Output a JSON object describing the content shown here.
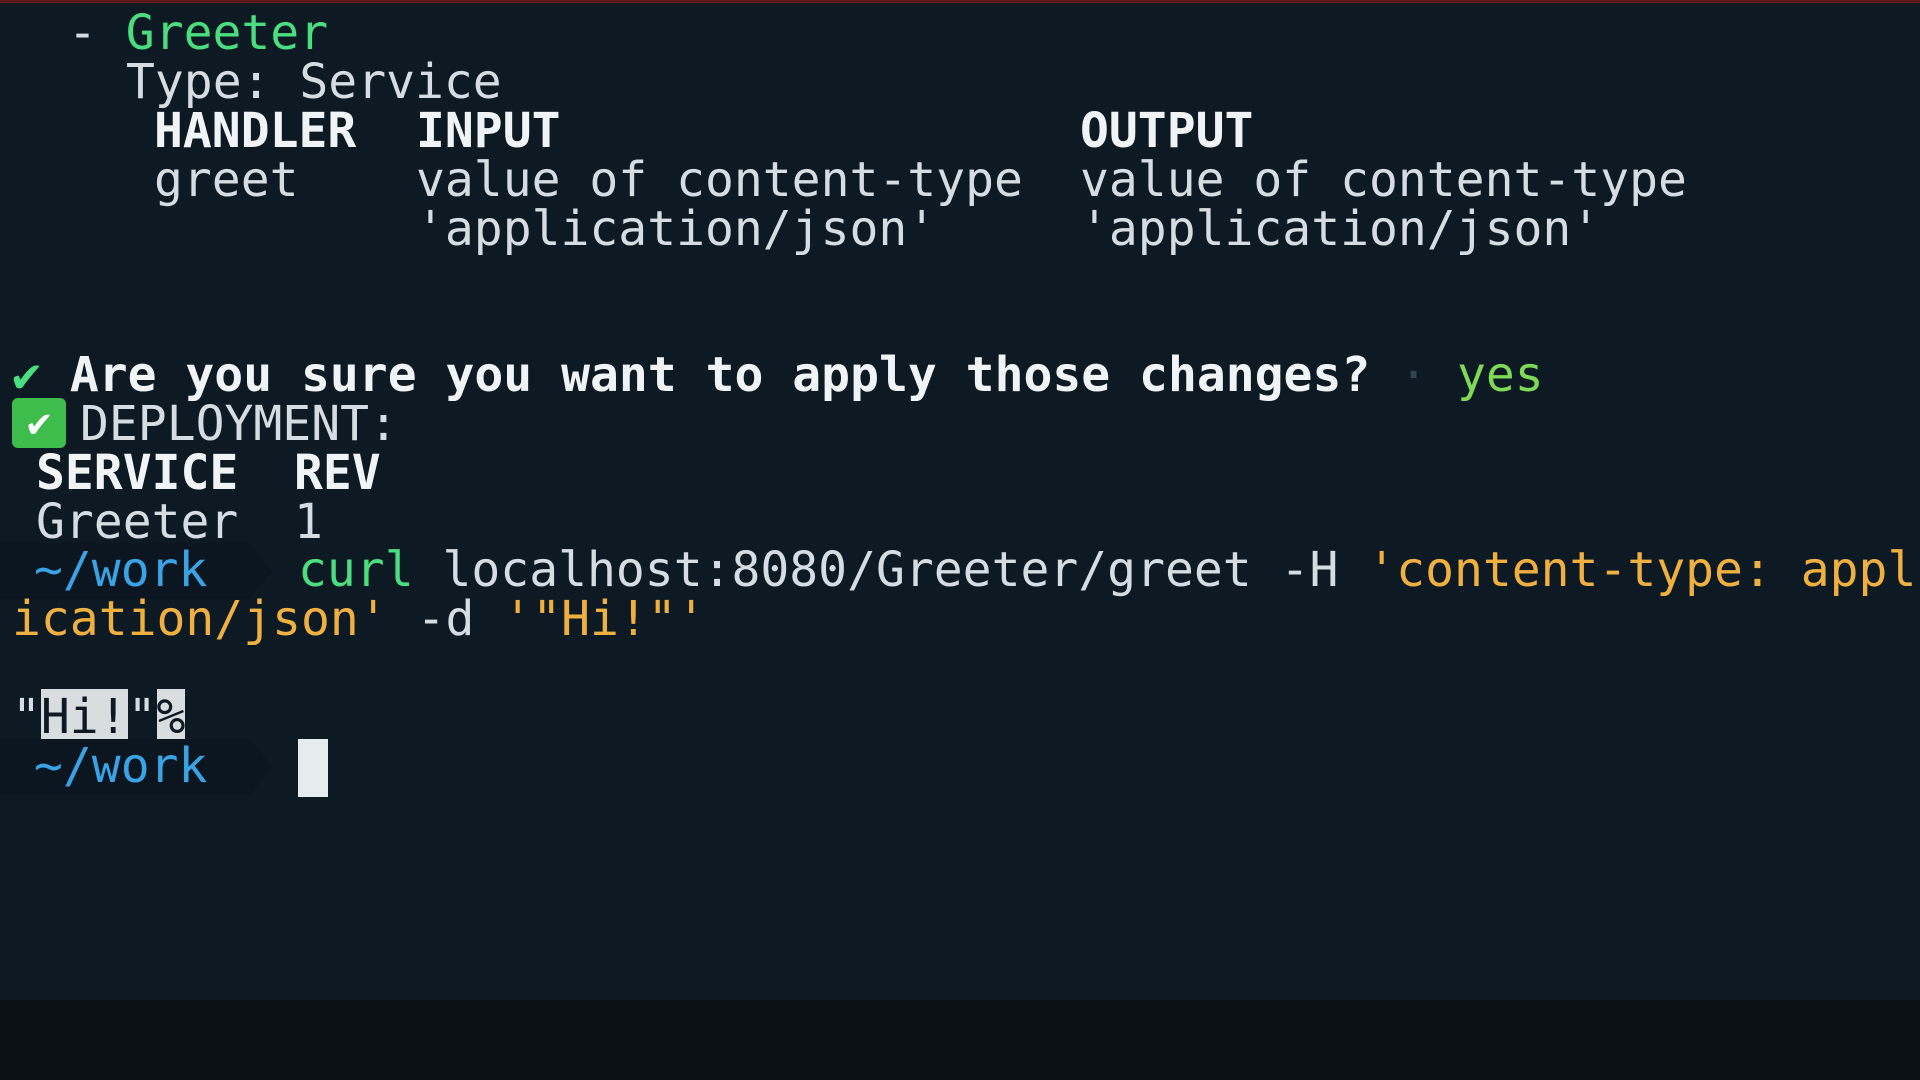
{
  "services": {
    "bullet": "- ",
    "name": "Greeter",
    "type_label": "Type:",
    "type_value": "Service",
    "table": {
      "headers": [
        "HANDLER",
        "INPUT",
        "OUTPUT"
      ],
      "rows": [
        [
          "greet",
          "value of content-type",
          "value of content-type"
        ],
        [
          "",
          "'application/json'",
          "'application/json'"
        ]
      ]
    }
  },
  "confirm": {
    "check": "✔",
    "question": "Are you sure you want to apply those changes?",
    "separator": "·",
    "answer": "yes"
  },
  "deployment": {
    "icon": "✔",
    "title": "DEPLOYMENT:",
    "headers": [
      "SERVICE",
      "REV"
    ],
    "rows": [
      [
        "Greeter",
        "1"
      ]
    ]
  },
  "prompt": {
    "cwd": "~/work"
  },
  "command": {
    "program": "curl",
    "args": "localhost:8080/Greeter/greet -H",
    "header_part1": "'content-type: appl",
    "header_part2": "ication/json'",
    "data_flag": "-d",
    "data_value": "'\"Hi!\"'"
  },
  "output": {
    "quote_open": "\"",
    "text": "Hi!",
    "quote_close": "\"",
    "eol_marker": "%"
  },
  "colors": {
    "background": "#0e1a23",
    "green": "#4ade80",
    "orange": "#f0b040",
    "blue": "#3aa3e6",
    "text": "#d6dde2"
  }
}
